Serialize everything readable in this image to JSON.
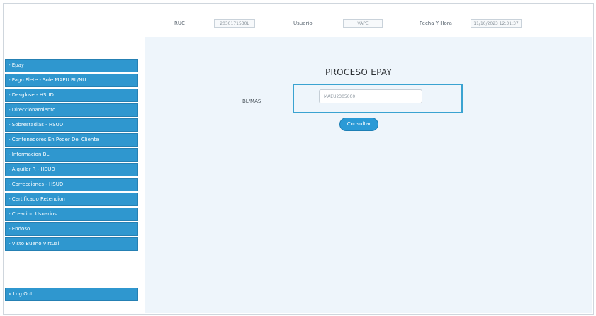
{
  "header": {
    "ruc_label": "RUC",
    "ruc_value": "2030171530L",
    "user_label": "Usuario",
    "user_value": "VAPE",
    "datetime_label": "Fecha Y Hora",
    "datetime_value": "11/10/2023 12:31:37"
  },
  "sidebar": {
    "items": [
      {
        "label": "- Epay"
      },
      {
        "label": "- Pago Flete - Sole MAEU BL/NU"
      },
      {
        "label": "- Desglose - HSUD"
      },
      {
        "label": "- Direccionamiento"
      },
      {
        "label": "- Sobrestadias - HSUD"
      },
      {
        "label": "- Contenedores En Poder Del Cliente"
      },
      {
        "label": "- Informacion BL"
      },
      {
        "label": "- Alquiler R - HSUD"
      },
      {
        "label": "- Correcciones - HSUD"
      },
      {
        "label": "- Certificado Retencion"
      },
      {
        "label": "- Creacion Usuarios"
      },
      {
        "label": "- Endoso"
      },
      {
        "label": "- Visto Bueno Virtual"
      }
    ],
    "logout_label": "» Log Out"
  },
  "main": {
    "title": "PROCESO EPAY",
    "field_label": "BL/MAS",
    "field_value": "MAEU2305000",
    "button_label": "Consultar"
  }
}
